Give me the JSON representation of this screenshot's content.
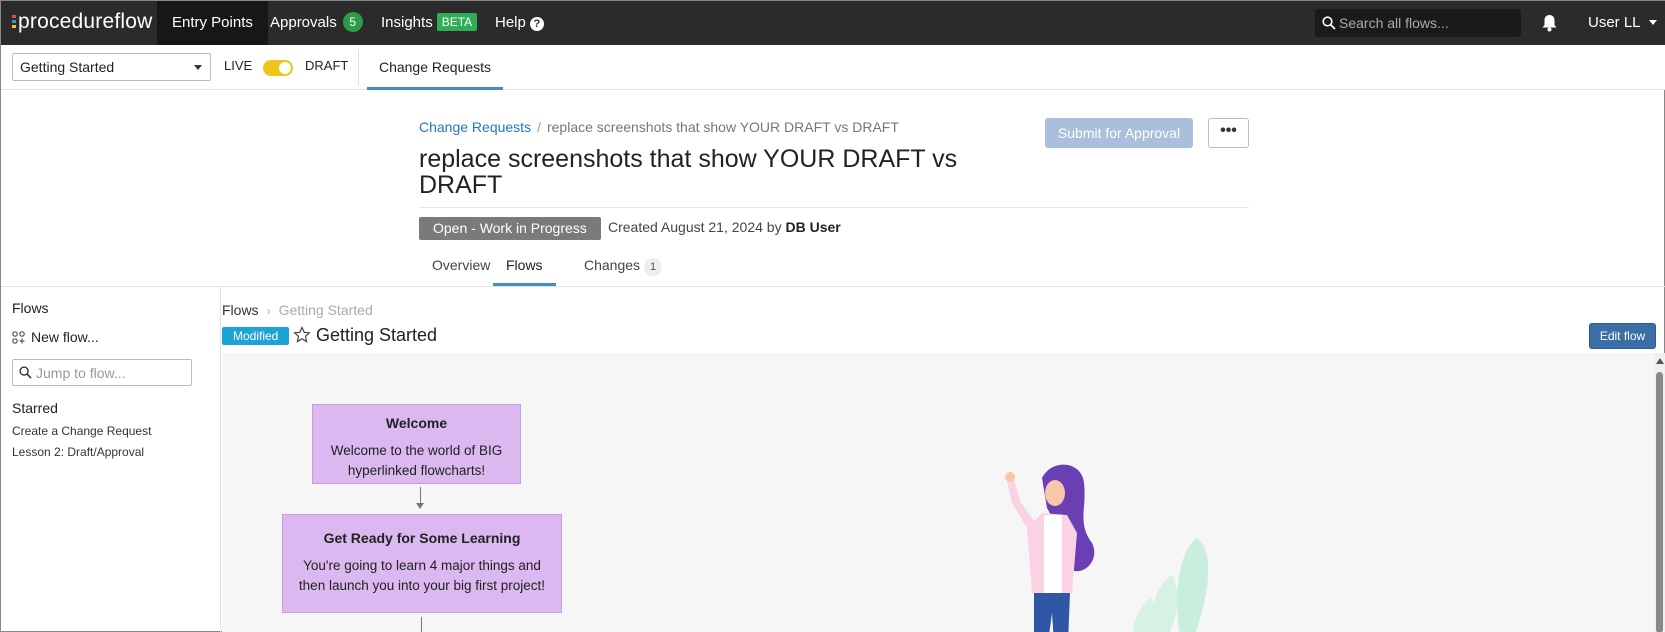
{
  "nav": {
    "logo": "procedureflow",
    "items": [
      {
        "label": "Entry Points"
      },
      {
        "label": "Approvals",
        "badge": "5"
      },
      {
        "label": "Insights",
        "badge": "BETA"
      },
      {
        "label": "Help",
        "badge": "?"
      }
    ],
    "search_placeholder": "Search all flows...",
    "user": "User LL"
  },
  "subbar": {
    "selected_flowset": "Getting Started",
    "live_label": "LIVE",
    "draft_label": "DRAFT",
    "tab": "Change Requests"
  },
  "header": {
    "breadcrumb_root": "Change Requests",
    "breadcrumb_sep": "/",
    "breadcrumb_current": "replace screenshots that show YOUR DRAFT vs DRAFT",
    "title": "replace screenshots that show YOUR DRAFT vs DRAFT",
    "submit_label": "Submit for Approval",
    "more_label": "•••",
    "status": "Open - Work in Progress",
    "created_prefix": "Created August 21, 2024 by",
    "created_by": "DB User",
    "tabs": [
      {
        "label": "Overview"
      },
      {
        "label": "Flows"
      },
      {
        "label": "Changes",
        "count": "1"
      }
    ]
  },
  "left": {
    "title": "Flows",
    "new_flow": "New flow...",
    "jump_placeholder": "Jump to flow...",
    "starred_title": "Starred",
    "starred": [
      "Create a Change Request",
      "Lesson 2: Draft/Approval"
    ]
  },
  "flow": {
    "bc_root": "Flows",
    "bc_sep": "›",
    "bc_current": "Getting Started",
    "modified": "Modified",
    "title": "Getting Started",
    "edit_label": "Edit flow",
    "nodes": [
      {
        "title": "Welcome",
        "line1": "Welcome to the world of BIG",
        "line2": "hyperlinked flowcharts!"
      },
      {
        "title": "Get Ready for Some Learning",
        "line1": "You're going to learn 4 major things and",
        "line2": "then launch you into your big first project!"
      }
    ]
  },
  "colors": {
    "nav_bg": "#2b2b2b",
    "accent": "#3f8fc4",
    "node_fill": "#dcb8f0",
    "modified": "#1ea3d6",
    "toggle": "#f0c419"
  }
}
